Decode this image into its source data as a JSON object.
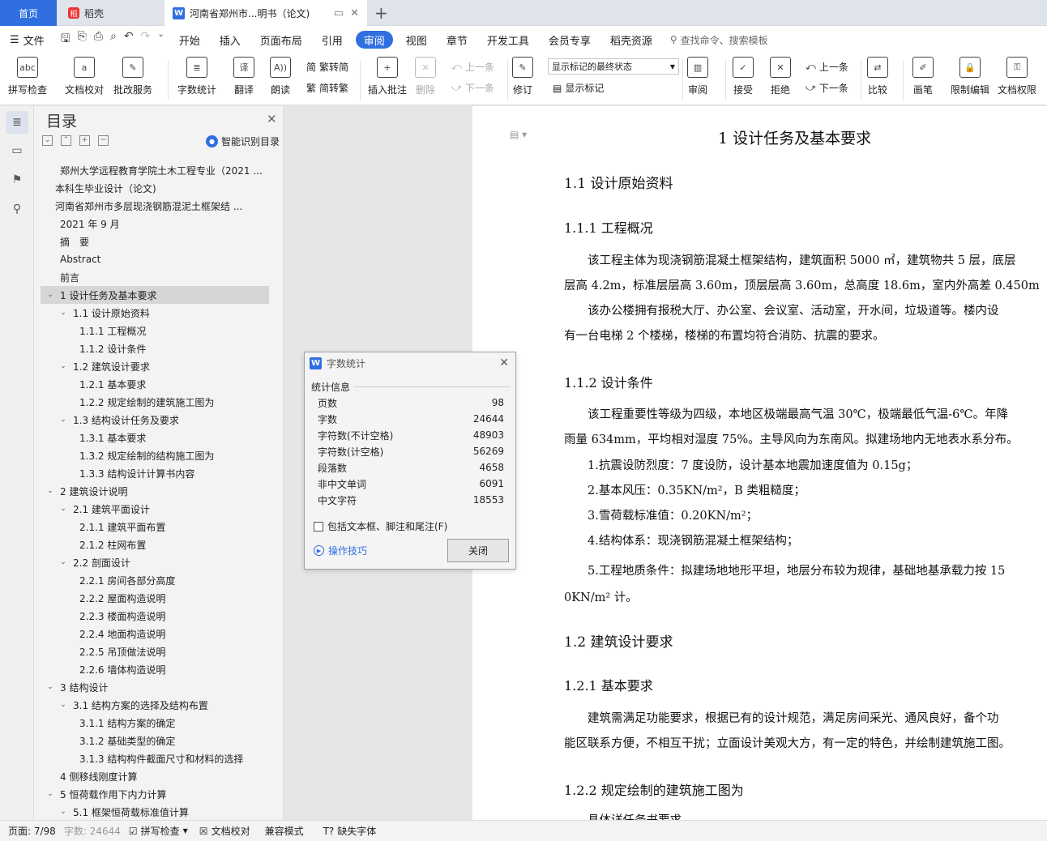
{
  "tabs": {
    "home": "首页",
    "doc1": "稻壳",
    "active": "河南省郑州市...明书（论文)"
  },
  "menu": {
    "file": "文件",
    "items": [
      "开始",
      "插入",
      "页面布局",
      "引用",
      "审阅",
      "视图",
      "章节",
      "开发工具",
      "会员专享",
      "稻壳资源"
    ],
    "active_index": 4,
    "search": "查找命令、搜索模板"
  },
  "ribbon": {
    "spellcheck": "拼写检查",
    "doccheck": "文档校对",
    "annotate_service": "批改服务",
    "wordcount": "字数统计",
    "translate": "翻译",
    "read": "朗读",
    "trad_to_simp": "繁转简",
    "simp_to_trad": "简转繁",
    "insert_comment": "插入批注",
    "delete": "删除",
    "prev": "上一条",
    "next": "下一条",
    "revise": "修订",
    "mark_state": "显示标记的最终状态",
    "show_marks": "显示标记",
    "review": "审阅",
    "accept": "接受",
    "reject": "拒绝",
    "prev2": "上一条",
    "next2": "下一条",
    "compare": "比较",
    "pen": "画笔",
    "restrict": "限制编辑",
    "doc_rights": "文档权限"
  },
  "nav": {
    "title": "目录",
    "smart": "智能识别目录",
    "items": [
      {
        "t": "郑州大学远程教育学院土木工程专业（2021 ...",
        "lvl": 0,
        "car": ""
      },
      {
        "t": "本科生毕业设计（论文)",
        "lvl": 0.6,
        "car": ""
      },
      {
        "t": "河南省郑州市多层现浇钢筋混泥土框架结 ...",
        "lvl": 0.6,
        "car": ""
      },
      {
        "t": "2021 年 9 月",
        "lvl": 0,
        "car": ""
      },
      {
        "t": "摘　要",
        "lvl": 0,
        "car": ""
      },
      {
        "t": "Abstract",
        "lvl": 0,
        "car": ""
      },
      {
        "t": "前言",
        "lvl": 0,
        "car": ""
      },
      {
        "t": "1  设计任务及基本要求",
        "lvl": 0,
        "car": "v",
        "sel": true
      },
      {
        "t": "1.1  设计原始资料",
        "lvl": 1,
        "car": "v"
      },
      {
        "t": "1.1.1  工程概况",
        "lvl": 2,
        "car": ""
      },
      {
        "t": "1.1.2  设计条件",
        "lvl": 2,
        "car": ""
      },
      {
        "t": "1.2  建筑设计要求",
        "lvl": 1,
        "car": "v"
      },
      {
        "t": "1.2.1 基本要求",
        "lvl": 2,
        "car": ""
      },
      {
        "t": "1.2.2 规定绘制的建筑施工图为",
        "lvl": 2,
        "car": ""
      },
      {
        "t": "1.3 结构设计任务及要求",
        "lvl": 1,
        "car": "v"
      },
      {
        "t": "1.3.1 基本要求",
        "lvl": 2,
        "car": ""
      },
      {
        "t": "1.3.2 规定绘制的结构施工图为",
        "lvl": 2,
        "car": ""
      },
      {
        "t": "1.3.3 结构设计计算书内容",
        "lvl": 2,
        "car": ""
      },
      {
        "t": "2  建筑设计说明",
        "lvl": 0,
        "car": "v"
      },
      {
        "t": "2.1 建筑平面设计",
        "lvl": 1,
        "car": "v"
      },
      {
        "t": "2.1.1 建筑平面布置",
        "lvl": 2,
        "car": ""
      },
      {
        "t": "2.1.2 柱网布置",
        "lvl": 2,
        "car": ""
      },
      {
        "t": "2.2 剖面设计",
        "lvl": 1,
        "car": "v"
      },
      {
        "t": "2.2.1 房间各部分高度",
        "lvl": 2,
        "car": ""
      },
      {
        "t": "2.2.2 屋面构造说明",
        "lvl": 2,
        "car": ""
      },
      {
        "t": "2.2.3 楼面构造说明",
        "lvl": 2,
        "car": ""
      },
      {
        "t": "2.2.4 地面构造说明",
        "lvl": 2,
        "car": ""
      },
      {
        "t": "2.2.5 吊顶做法说明",
        "lvl": 2,
        "car": ""
      },
      {
        "t": "2.2.6 墙体构造说明",
        "lvl": 2,
        "car": ""
      },
      {
        "t": "3  结构设计",
        "lvl": 0,
        "car": "v"
      },
      {
        "t": "3.1  结构方案的选择及结构布置",
        "lvl": 1,
        "car": "v"
      },
      {
        "t": "3.1.1  结构方案的确定",
        "lvl": 2,
        "car": ""
      },
      {
        "t": "3.1.2  基础类型的确定",
        "lvl": 2,
        "car": ""
      },
      {
        "t": "3.1.3  结构构件截面尺寸和材料的选择",
        "lvl": 2,
        "car": ""
      },
      {
        "t": "4  侧移线刚度计算",
        "lvl": 0,
        "car": ""
      },
      {
        "t": "5  恒荷载作用下内力计算",
        "lvl": 0,
        "car": "v"
      },
      {
        "t": "5.1  框架恒荷载标准值计算",
        "lvl": 1,
        "car": "v"
      }
    ]
  },
  "doc": {
    "h1": "1  设计任务及基本要求",
    "h2a": "1.1  设计原始资料",
    "h3a": "1.1.1  工程概况",
    "p1": "　　该工程主体为现浇钢筋混凝土框架结构，建筑面积 5000 ㎡，建筑物共 5 层，底层",
    "p2": "层高 4.2m，标准层层高 3.60m，顶层层高 3.60m，总高度 18.6m，室内外高差 0.450m",
    "p3": "　　该办公楼拥有报税大厅、办公室、会议室、活动室，开水间，垃圾道等。楼内设",
    "p4": "有一台电梯 2 个楼梯，楼梯的布置均符合消防、抗震的要求。",
    "h3b": "1.1.2  设计条件",
    "p5": "　　该工程重要性等级为四级，本地区极端最高气温 30℃，极端最低气温-6℃。年降",
    "p6": "雨量 634mm，平均相对湿度 75%。主导风向为东南风。拟建场地内无地表水系分布。",
    "p7": "　　1.抗震设防烈度：7 度设防，设计基本地震加速度值为 0.15g；",
    "p8": "　　2.基本风压：0.35KN/m²，B 类粗糙度；",
    "p9": "　　3.雪荷载标准值：0.20KN/m²；",
    "p10": "　　4.结构体系：现浇钢筋混凝土框架结构；",
    "p11": "　　5.工程地质条件：拟建场地地形平坦，地层分布较为规律，基础地基承载力按 15",
    "p12": "0KN/m² 计。",
    "h2b": "1.2  建筑设计要求",
    "h3c": "1.2.1 基本要求",
    "p13": "　　建筑需满足功能要求，根据已有的设计规范，满足房间采光、通风良好，备个功",
    "p14": "能区联系方便，不相互干扰；立面设计美观大方，有一定的特色，并绘制建筑施工图。",
    "h3d": "1.2.2 规定绘制的建筑施工图为",
    "p15": "　　具体详任务书要求"
  },
  "dialog": {
    "title": "字数统计",
    "section": "统计信息",
    "stats": [
      {
        "k": "页数",
        "v": "98"
      },
      {
        "k": "字数",
        "v": "24644"
      },
      {
        "k": "字符数(不计空格)",
        "v": "48903"
      },
      {
        "k": "字符数(计空格)",
        "v": "56269"
      },
      {
        "k": "段落数",
        "v": "4658"
      },
      {
        "k": "非中文单词",
        "v": "6091"
      },
      {
        "k": "中文字符",
        "v": "18553"
      }
    ],
    "include": "包括文本框、脚注和尾注(F)",
    "tips": "操作技巧",
    "close": "关闭"
  },
  "status": {
    "page": "页面: 7/98",
    "words": "字数: 24644",
    "spell": "拼写检查",
    "doccheck": "文档校对",
    "compat": "兼容模式",
    "missing_font": "缺失字体"
  },
  "colors": {
    "accent": "#2f6fe0",
    "tabbar": "#dfe3ea",
    "selection": "#d6d6d6"
  }
}
